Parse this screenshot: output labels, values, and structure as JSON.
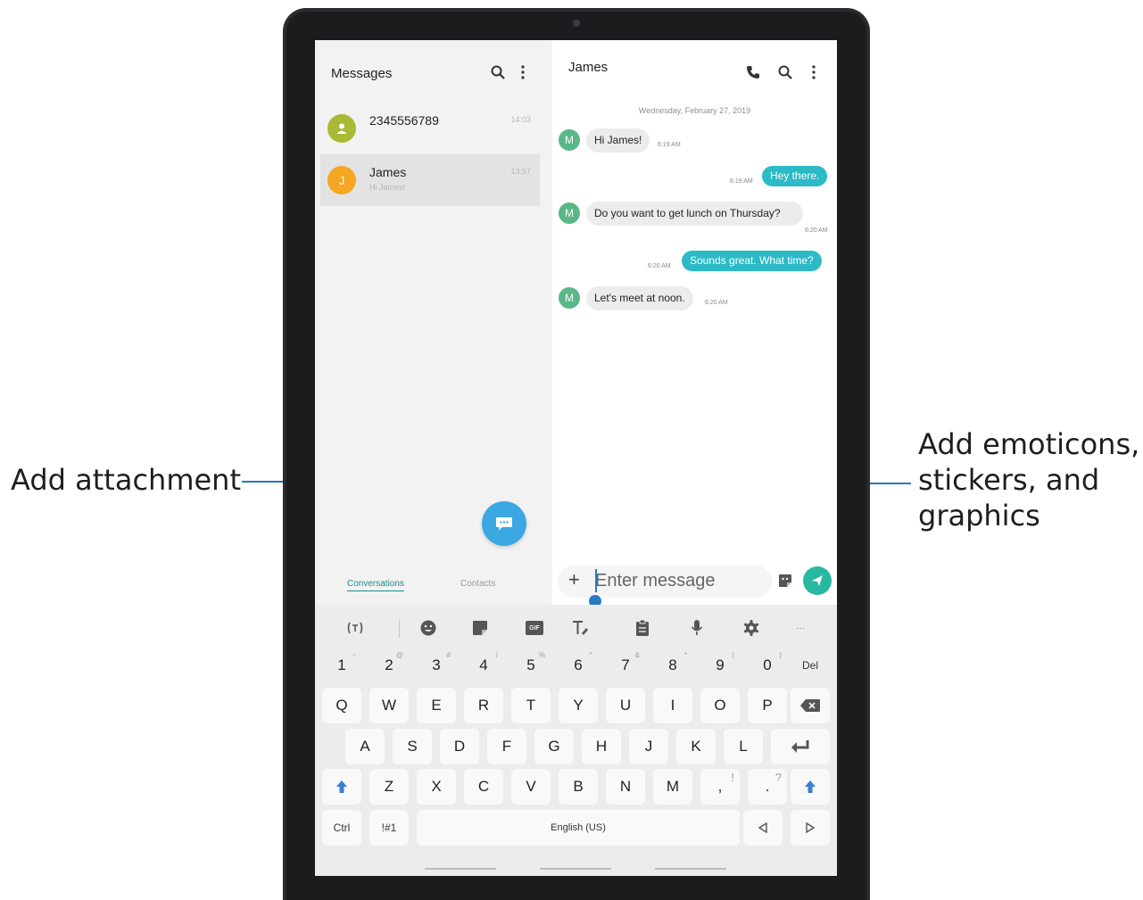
{
  "left_pane": {
    "title": "Messages",
    "conversations": [
      {
        "name": "2345556789",
        "time": "14:03",
        "preview": "",
        "avatar_letter": "",
        "avatar_color": "#a9b935"
      },
      {
        "name": "James",
        "time": "13:57",
        "preview": "Hi James!",
        "avatar_letter": "J",
        "avatar_color": "#f5a623"
      }
    ],
    "tabs": [
      "Conversations",
      "Contacts"
    ]
  },
  "chat": {
    "title": "James",
    "date": "Wednesday, February 27, 2019",
    "avatar_letter": "M",
    "messages": [
      {
        "dir": "in",
        "text": "Hi James!",
        "time": "6:19 AM"
      },
      {
        "dir": "out",
        "text": "Hey there.",
        "time": "6:19 AM"
      },
      {
        "dir": "in",
        "text": "Do you want to get lunch on Thursday?",
        "time": "6:20 AM"
      },
      {
        "dir": "out",
        "text": "Sounds great. What time?",
        "time": "6:20 AM"
      },
      {
        "dir": "in",
        "text": "Let's meet at noon.",
        "time": "6:20 AM"
      }
    ],
    "input_placeholder": "Enter message",
    "plus_glyph": "+"
  },
  "keyboard": {
    "toolbar_more": "···",
    "gif_label": "GIF",
    "number_row": [
      {
        "k": "1",
        "s": "~"
      },
      {
        "k": "2",
        "s": "@"
      },
      {
        "k": "3",
        "s": "#"
      },
      {
        "k": "4",
        "s": "/"
      },
      {
        "k": "5",
        "s": "%"
      },
      {
        "k": "6",
        "s": "^"
      },
      {
        "k": "7",
        "s": "&"
      },
      {
        "k": "8",
        "s": "*"
      },
      {
        "k": "9",
        "s": "("
      },
      {
        "k": "0",
        "s": ")"
      }
    ],
    "del_label": "Del",
    "row1": [
      "Q",
      "W",
      "E",
      "R",
      "T",
      "Y",
      "U",
      "I",
      "O",
      "P"
    ],
    "row2": [
      "A",
      "S",
      "D",
      "F",
      "G",
      "H",
      "J",
      "K",
      "L"
    ],
    "row3": [
      "Z",
      "X",
      "C",
      "V",
      "B",
      "N",
      "M"
    ],
    "comma": ",",
    "comma_sub": "!",
    "period": ".",
    "period_sub": "?",
    "ctrl_label": "Ctrl",
    "symbols_label": "!#1",
    "space_label": "English (US)"
  },
  "callouts": {
    "attachment": "Add attachment",
    "emoticons": "Add emoticons, stickers, and graphics"
  },
  "colors": {
    "accent_teal": "#2bbac6",
    "fab_blue": "#3ba7e3",
    "callout_line": "#2c78b6"
  }
}
